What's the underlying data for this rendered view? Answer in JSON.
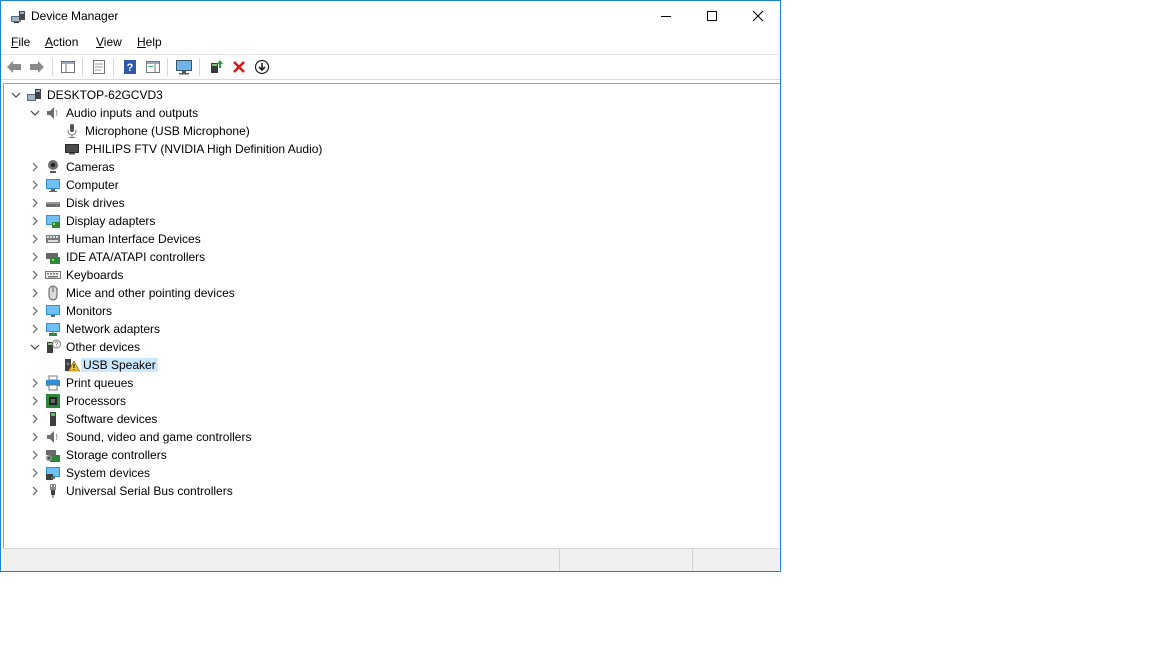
{
  "window": {
    "title": "Device Manager",
    "controls": [
      "minimize",
      "maximize",
      "close"
    ]
  },
  "menu": [
    {
      "accel": "F",
      "rest": "ile"
    },
    {
      "accel": "A",
      "rest": "ction"
    },
    {
      "accel": "V",
      "rest": "iew"
    },
    {
      "accel": "H",
      "rest": "elp"
    }
  ],
  "toolbar": {
    "buttons": [
      "back",
      "forward",
      "show-hide-console-tree",
      "properties",
      "help",
      "action-pane",
      "scan-for-hardware-changes",
      "update-driver",
      "uninstall-device",
      "disable-device"
    ]
  },
  "tree": {
    "root": "DESKTOP-62GCVD3",
    "nodes": [
      {
        "label": "Audio inputs and outputs",
        "icon": "speaker-icon",
        "expanded": true
      },
      {
        "label": "Microphone (USB Microphone)",
        "icon": "microphone-icon",
        "child": true
      },
      {
        "label": "PHILIPS FTV (NVIDIA High Definition Audio)",
        "icon": "tv-monitor-icon",
        "child": true
      },
      {
        "label": "Cameras",
        "icon": "camera-icon"
      },
      {
        "label": "Computer",
        "icon": "computer-icon"
      },
      {
        "label": "Disk drives",
        "icon": "disk-drive-icon"
      },
      {
        "label": "Display adapters",
        "icon": "display-adapter-icon"
      },
      {
        "label": "Human Interface Devices",
        "icon": "hid-icon"
      },
      {
        "label": "IDE ATA/ATAPI controllers",
        "icon": "ide-controller-icon"
      },
      {
        "label": "Keyboards",
        "icon": "keyboard-icon"
      },
      {
        "label": "Mice and other pointing devices",
        "icon": "mouse-icon"
      },
      {
        "label": "Monitors",
        "icon": "monitor-icon"
      },
      {
        "label": "Network adapters",
        "icon": "network-adapter-icon"
      },
      {
        "label": "Other devices",
        "icon": "unknown-device-icon",
        "expanded": true
      },
      {
        "label": "USB Speaker",
        "icon": "warning-device-icon",
        "child": true,
        "selected": true
      },
      {
        "label": "Print queues",
        "icon": "printer-icon"
      },
      {
        "label": "Processors",
        "icon": "processor-icon"
      },
      {
        "label": "Software devices",
        "icon": "software-device-icon"
      },
      {
        "label": "Sound, video and game controllers",
        "icon": "sound-controller-icon"
      },
      {
        "label": "Storage controllers",
        "icon": "storage-controller-icon"
      },
      {
        "label": "System devices",
        "icon": "system-devices-icon"
      },
      {
        "label": "Universal Serial Bus controllers",
        "icon": "usb-icon"
      }
    ]
  },
  "colors": {
    "accent_border": "#1883d7",
    "selection": "#cce8ff"
  }
}
